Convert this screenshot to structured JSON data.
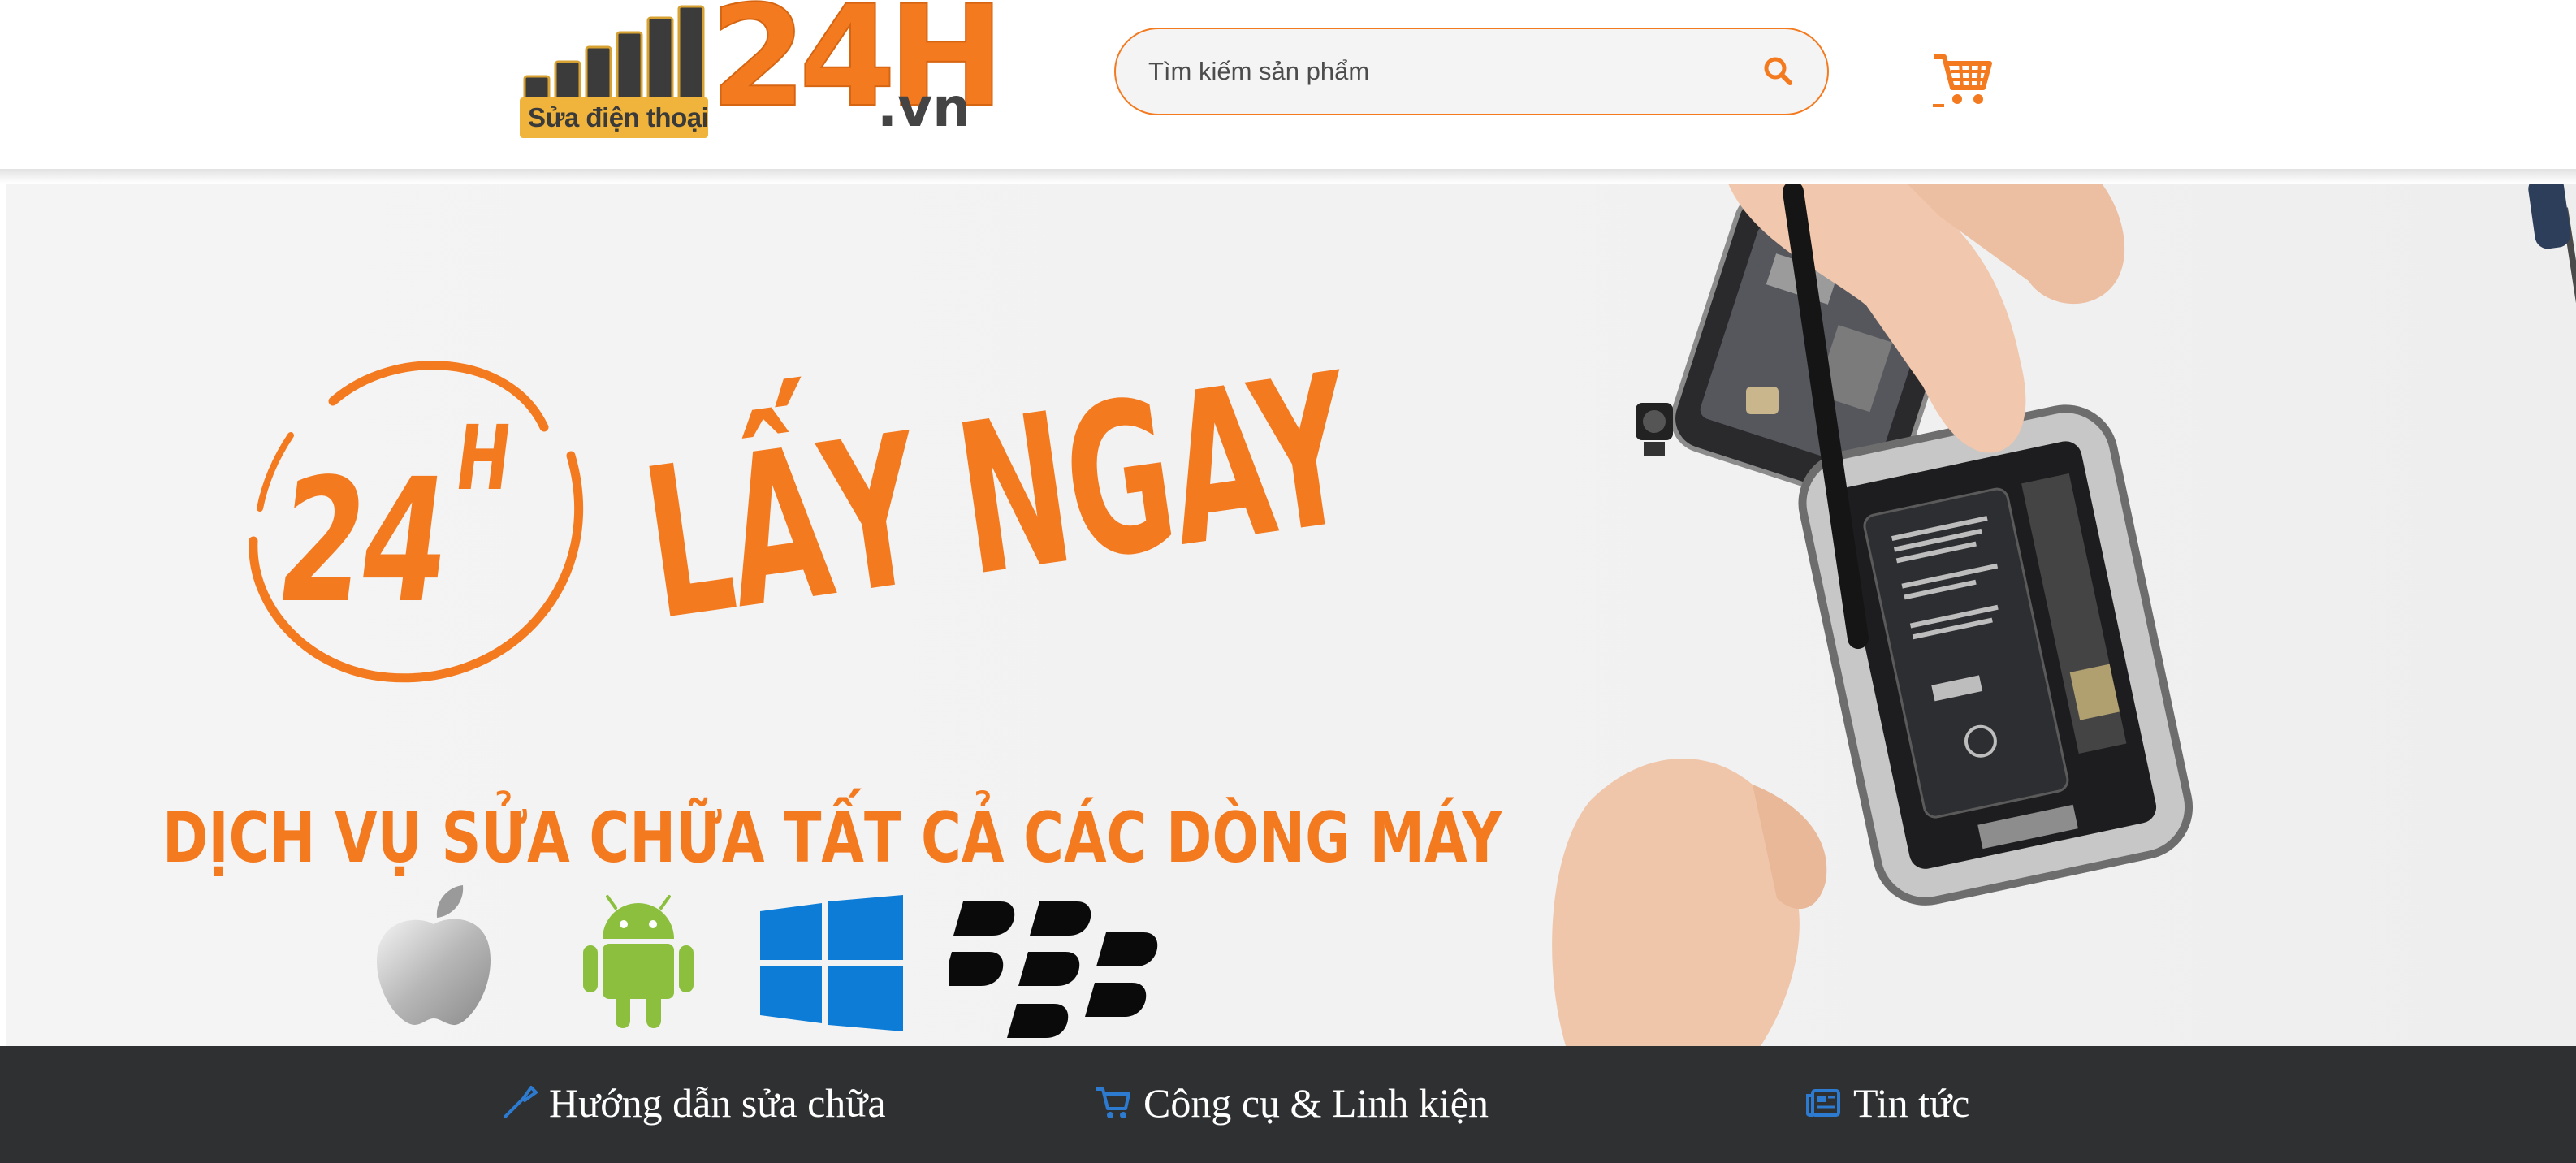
{
  "header": {
    "logo": {
      "tagline": "Sửa điện thoại",
      "brand_big": "24H",
      "brand_suffix": ".vn"
    },
    "search": {
      "placeholder": "Tìm kiếm sản phẩm",
      "value": "",
      "icon": "search-icon"
    },
    "cart": {
      "icon": "cart-icon"
    }
  },
  "banner": {
    "badge_number": "24",
    "badge_superscript": "H",
    "headline": "LẤY NGAY",
    "subline": "DỊCH VỤ SỬA CHỮA TẤT CẢ CÁC DÒNG MÁY",
    "os_icons": [
      "apple-logo",
      "android-logo",
      "windows-logo",
      "blackberry-logo"
    ]
  },
  "nav": {
    "items": [
      {
        "label": "Hướng dẫn sửa chữa",
        "icon": "screwdriver-icon"
      },
      {
        "label": "Công cụ & Linh kiện",
        "icon": "cart-icon"
      },
      {
        "label": "Tin tức",
        "icon": "newspaper-icon"
      }
    ]
  },
  "colors": {
    "brand_orange": "#f47a20",
    "nav_background": "#2f3032",
    "nav_icon_blue": "#2d7bd0",
    "windows_blue": "#0d7cd6",
    "android_green": "#8bbf3d"
  }
}
